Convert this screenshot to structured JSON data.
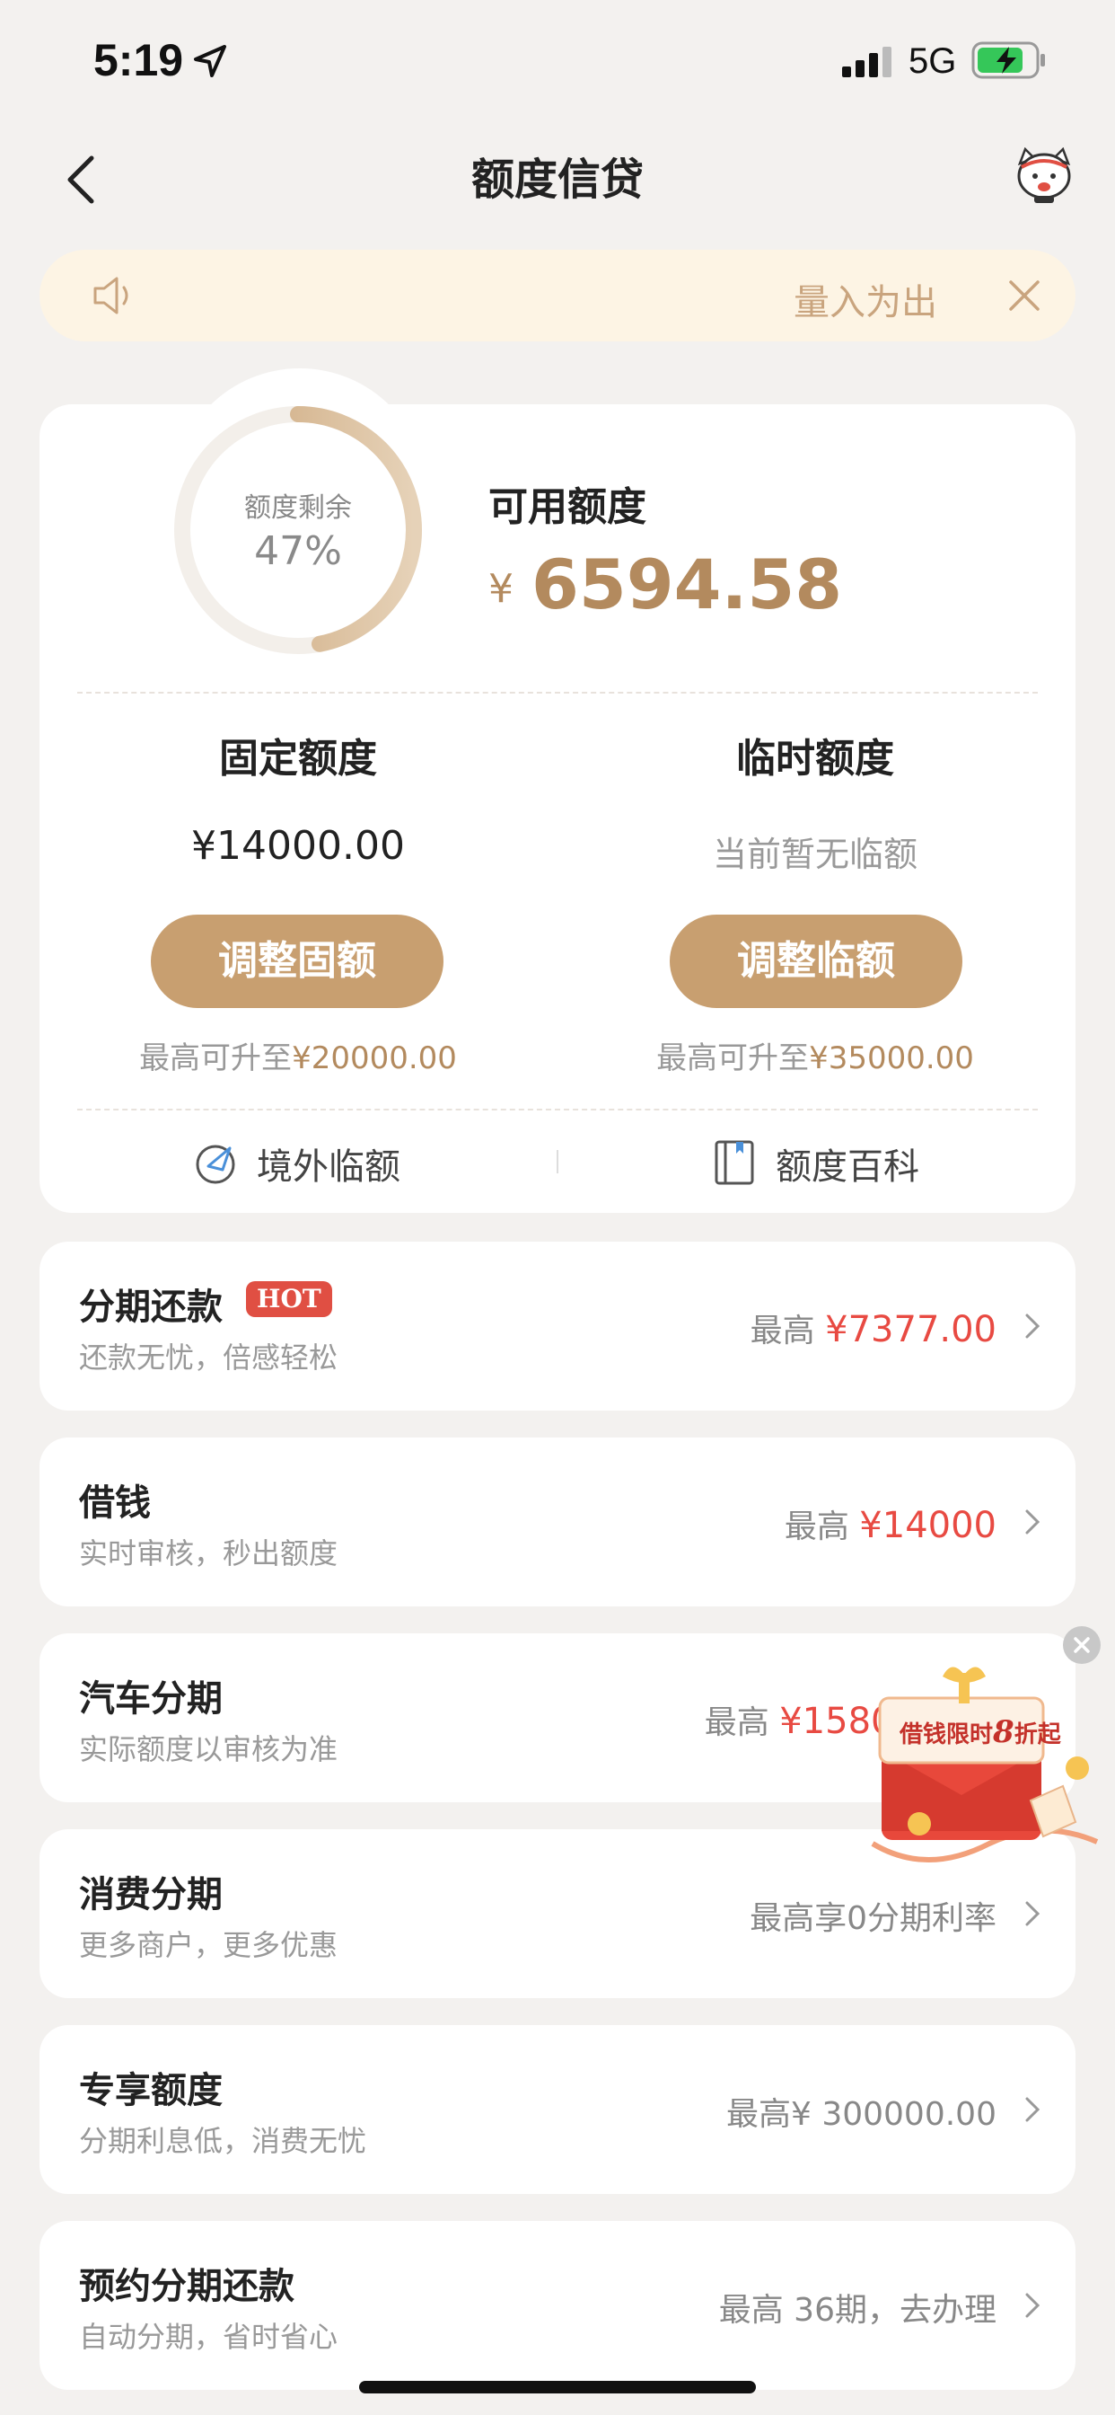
{
  "status_bar": {
    "time": "5:19",
    "network": "5G"
  },
  "nav": {
    "title": "额度信贷"
  },
  "notice": {
    "text": "量入为出"
  },
  "credit": {
    "remaining_label": "额度剩余",
    "remaining_percent": "47%",
    "remaining_fraction": 0.47,
    "available_label": "可用额度",
    "currency": "¥",
    "available_amount": "6594.58"
  },
  "fixed": {
    "title": "固定额度",
    "value": "¥14000.00",
    "button": "调整固额",
    "hint_prefix": "最高可升至",
    "hint_amount": "¥20000.00"
  },
  "temporary": {
    "title": "临时额度",
    "value": "当前暂无临额",
    "button": "调整临额",
    "hint_prefix": "最高可升至",
    "hint_amount": "¥35000.00"
  },
  "links": {
    "overseas": "境外临额",
    "wiki": "额度百科"
  },
  "list": [
    {
      "title": "分期还款",
      "badge": "HOT",
      "subtitle": "还款无忧，倍感轻松",
      "right_prefix": "最高",
      "right_amount": "¥7377.00"
    },
    {
      "title": "借钱",
      "subtitle": "实时审核，秒出额度",
      "right_prefix": "最高",
      "right_amount": "¥14000"
    },
    {
      "title": "汽车分期",
      "subtitle": "实际额度以审核为准",
      "right_prefix": "最高",
      "right_amount": "¥158000.00"
    },
    {
      "title": "消费分期",
      "subtitle": "更多商户，更多优惠",
      "right_text": "最高享0分期利率"
    },
    {
      "title": "专享额度",
      "subtitle": "分期利息低，消费无忧",
      "right_text": "最高¥ 300000.00"
    },
    {
      "title": "预约分期还款",
      "subtitle": "自动分期，省时省心",
      "right_text": "最高 36期，去办理"
    }
  ],
  "ad": {
    "text_a": "借钱限时",
    "text_b": "8",
    "text_c": "折起"
  },
  "colors": {
    "accent": "#c89f70",
    "gold_text": "#b38a5e",
    "price_red": "#e84a42",
    "hot_badge": "#e04f43"
  }
}
